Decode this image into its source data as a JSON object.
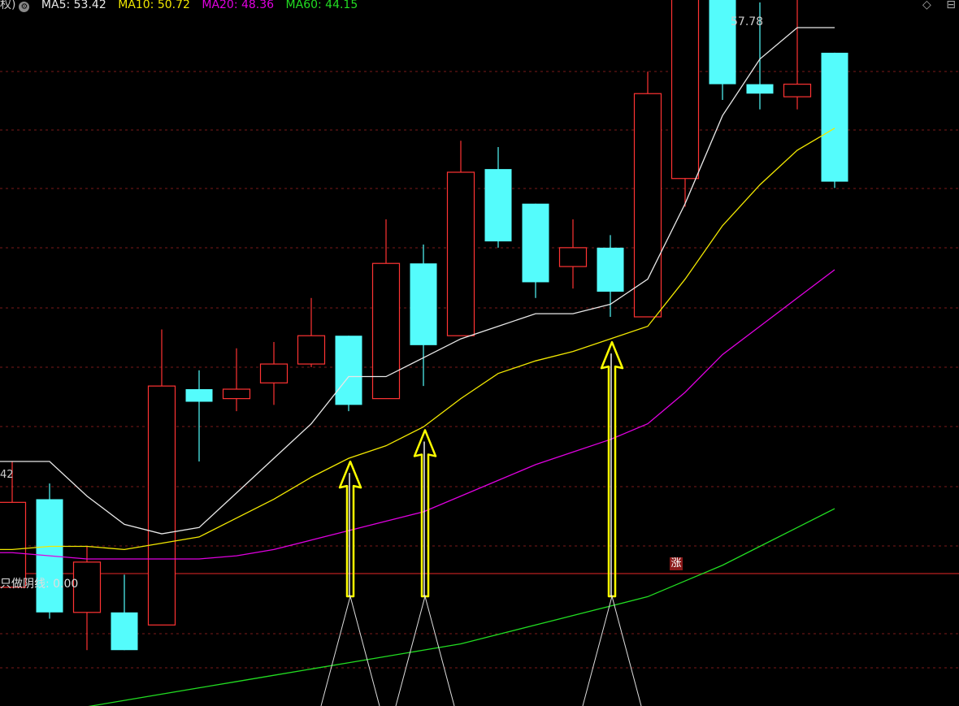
{
  "legend": {
    "prefix": "权)",
    "items": [
      {
        "text": "MA5: 53.42",
        "color": "#e8e8e8"
      },
      {
        "text": "MA10: 50.72",
        "color": "#f2e800"
      },
      {
        "text": "MA20: 48.36",
        "color": "#e000e0"
      },
      {
        "text": "MA60: 44.15",
        "color": "#22dd22"
      }
    ]
  },
  "controls": {
    "diamond": "◇",
    "collapse": "⊟"
  },
  "max_label": "57.78",
  "left_price_label": "42",
  "lower_panel": {
    "label": "只做阴线: 0.00",
    "badge": "涨"
  },
  "chart_data": {
    "type": "candlestick",
    "colors": {
      "up": "#ff3333",
      "down": "#54fcfc",
      "ma5": "#e8e8e8",
      "ma10": "#f2e800",
      "ma20": "#e000e0",
      "ma60": "#22dd22",
      "arrow": "#ffff00"
    },
    "candles": [
      {
        "o": 39.8,
        "c": 42.5,
        "h": 43.8,
        "l": 39.8
      },
      {
        "o": 42.6,
        "c": 39.0,
        "h": 43.1,
        "l": 38.8
      },
      {
        "o": 39.0,
        "c": 40.6,
        "h": 41.1,
        "l": 37.8
      },
      {
        "o": 39.0,
        "c": 37.8,
        "h": 40.2,
        "l": 37.8
      },
      {
        "o": 38.6,
        "c": 46.2,
        "h": 48.0,
        "l": 38.6
      },
      {
        "o": 46.1,
        "c": 45.7,
        "h": 46.7,
        "l": 43.8
      },
      {
        "o": 45.8,
        "c": 46.1,
        "h": 47.4,
        "l": 45.4
      },
      {
        "o": 46.3,
        "c": 46.9,
        "h": 47.6,
        "l": 45.6
      },
      {
        "o": 46.9,
        "c": 47.8,
        "h": 49.0,
        "l": 46.8
      },
      {
        "o": 47.8,
        "c": 45.6,
        "h": 47.8,
        "l": 45.4
      },
      {
        "o": 45.8,
        "c": 50.1,
        "h": 51.5,
        "l": 45.8
      },
      {
        "o": 50.1,
        "c": 47.5,
        "h": 50.7,
        "l": 46.2
      },
      {
        "o": 47.8,
        "c": 53.0,
        "h": 54.0,
        "l": 47.8
      },
      {
        "o": 53.1,
        "c": 50.8,
        "h": 53.8,
        "l": 50.6
      },
      {
        "o": 52.0,
        "c": 49.5,
        "h": 52.0,
        "l": 49.0
      },
      {
        "o": 50.0,
        "c": 50.6,
        "h": 51.5,
        "l": 49.3
      },
      {
        "o": 50.6,
        "c": 49.2,
        "h": 51.0,
        "l": 48.4
      },
      {
        "o": 48.4,
        "c": 55.5,
        "h": 56.2,
        "l": 48.4
      },
      {
        "o": 52.8,
        "c": 59.6,
        "h": 59.6,
        "l": 51.9
      },
      {
        "o": 58.8,
        "c": 55.8,
        "h": 62.8,
        "l": 55.3
      },
      {
        "o": 55.8,
        "c": 55.5,
        "h": 58.4,
        "l": 55.0
      },
      {
        "o": 55.4,
        "c": 55.8,
        "h": 59.2,
        "l": 55.0
      },
      {
        "o": 56.8,
        "c": 52.7,
        "h": 56.8,
        "l": 52.5
      }
    ],
    "ma5": [
      43.8,
      43.8,
      42.7,
      41.8,
      41.5,
      41.7,
      42.8,
      43.9,
      45.0,
      46.5,
      46.5,
      47.1,
      47.7,
      48.1,
      48.5,
      48.5,
      48.8,
      49.6,
      52.0,
      54.8,
      56.6,
      57.6,
      57.6
    ],
    "ma10": [
      41.0,
      41.1,
      41.1,
      41.0,
      41.2,
      41.4,
      42.0,
      42.6,
      43.3,
      43.9,
      44.3,
      44.9,
      45.8,
      46.6,
      47.0,
      47.3,
      47.7,
      48.1,
      49.6,
      51.3,
      52.6,
      53.7,
      54.4
    ],
    "ma20": [
      40.9,
      40.8,
      40.7,
      40.7,
      40.7,
      40.7,
      40.8,
      41.0,
      41.3,
      41.6,
      41.9,
      42.2,
      42.7,
      43.2,
      43.7,
      44.1,
      44.5,
      45.0,
      46.0,
      47.2,
      48.1,
      49.0,
      49.9
    ],
    "ma60": [
      35.6,
      35.8,
      36.0,
      36.2,
      36.4,
      36.6,
      36.8,
      37.0,
      37.2,
      37.4,
      37.6,
      37.8,
      38.0,
      38.3,
      38.6,
      38.9,
      39.2,
      39.5,
      40.0,
      40.5,
      41.1,
      41.7,
      42.3
    ],
    "arrow_candle_indices": [
      9,
      11,
      16
    ],
    "max_value": 57.78
  }
}
